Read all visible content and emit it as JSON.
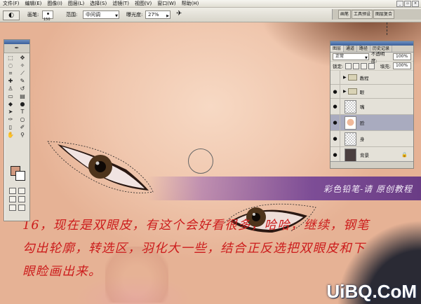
{
  "menu": [
    "文件(F)",
    "编辑(E)",
    "图像(I)",
    "图层(L)",
    "选择(S)",
    "滤镜(T)",
    "视图(V)",
    "窗口(W)",
    "帮助(H)"
  ],
  "options": {
    "brush_label": "画笔:",
    "brush_size": "150",
    "range_label": "范围:",
    "range_value": "中间调",
    "exposure_label": "曝光度:",
    "exposure_value": "27%",
    "wells": [
      "画笔",
      "工具预设",
      "图层复合"
    ]
  },
  "layers_panel": {
    "tabs": [
      "图层",
      "通道",
      "路径",
      "历史记录"
    ],
    "blend_mode": "正常",
    "opacity_label": "不透明度:",
    "opacity_value": "100%",
    "lock_label": "锁定:",
    "fill_label": "填充:",
    "fill_value": "100%",
    "layers": [
      {
        "name": "教程",
        "kind": "group",
        "visible": false
      },
      {
        "name": "眼",
        "kind": "group",
        "visible": true
      },
      {
        "name": "嘴",
        "kind": "layer",
        "visible": true
      },
      {
        "name": "脸",
        "kind": "layer",
        "visible": true,
        "active": true
      },
      {
        "name": "身",
        "kind": "layer",
        "visible": true
      },
      {
        "name": "背景",
        "kind": "background",
        "visible": true,
        "locked": true
      }
    ]
  },
  "canvas": {
    "banner_text": "彩色铅笔-请 原创教程",
    "caption_line1": "16，现在是双眼皮，有这个会好看很多，哈哈，继续，钢笔",
    "caption_line2": "勾出轮廓，转选区，羽化大一些，结合正反选把双眼皮和下",
    "caption_line3": "眼睑画出来。",
    "watermark": "UiBQ.CoM"
  },
  "colors": {
    "foreground": "#d29a80",
    "background": "#ffffff",
    "caption": "#cc1c1c",
    "banner": "#7d4d96"
  }
}
